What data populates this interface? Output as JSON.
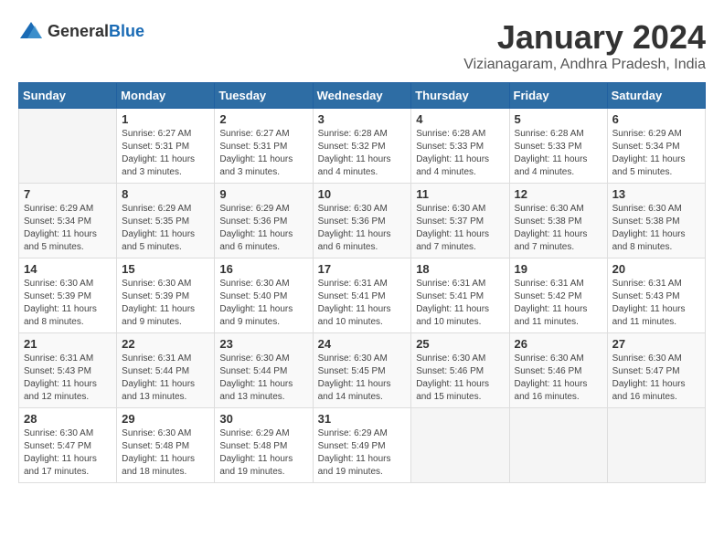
{
  "logo": {
    "text_general": "General",
    "text_blue": "Blue"
  },
  "header": {
    "month": "January 2024",
    "location": "Vizianagaram, Andhra Pradesh, India"
  },
  "days_of_week": [
    "Sunday",
    "Monday",
    "Tuesday",
    "Wednesday",
    "Thursday",
    "Friday",
    "Saturday"
  ],
  "weeks": [
    [
      {
        "day": "",
        "info": ""
      },
      {
        "day": "1",
        "info": "Sunrise: 6:27 AM\nSunset: 5:31 PM\nDaylight: 11 hours\nand 3 minutes."
      },
      {
        "day": "2",
        "info": "Sunrise: 6:27 AM\nSunset: 5:31 PM\nDaylight: 11 hours\nand 3 minutes."
      },
      {
        "day": "3",
        "info": "Sunrise: 6:28 AM\nSunset: 5:32 PM\nDaylight: 11 hours\nand 4 minutes."
      },
      {
        "day": "4",
        "info": "Sunrise: 6:28 AM\nSunset: 5:33 PM\nDaylight: 11 hours\nand 4 minutes."
      },
      {
        "day": "5",
        "info": "Sunrise: 6:28 AM\nSunset: 5:33 PM\nDaylight: 11 hours\nand 4 minutes."
      },
      {
        "day": "6",
        "info": "Sunrise: 6:29 AM\nSunset: 5:34 PM\nDaylight: 11 hours\nand 5 minutes."
      }
    ],
    [
      {
        "day": "7",
        "info": "Sunrise: 6:29 AM\nSunset: 5:34 PM\nDaylight: 11 hours\nand 5 minutes."
      },
      {
        "day": "8",
        "info": "Sunrise: 6:29 AM\nSunset: 5:35 PM\nDaylight: 11 hours\nand 5 minutes."
      },
      {
        "day": "9",
        "info": "Sunrise: 6:29 AM\nSunset: 5:36 PM\nDaylight: 11 hours\nand 6 minutes."
      },
      {
        "day": "10",
        "info": "Sunrise: 6:30 AM\nSunset: 5:36 PM\nDaylight: 11 hours\nand 6 minutes."
      },
      {
        "day": "11",
        "info": "Sunrise: 6:30 AM\nSunset: 5:37 PM\nDaylight: 11 hours\nand 7 minutes."
      },
      {
        "day": "12",
        "info": "Sunrise: 6:30 AM\nSunset: 5:38 PM\nDaylight: 11 hours\nand 7 minutes."
      },
      {
        "day": "13",
        "info": "Sunrise: 6:30 AM\nSunset: 5:38 PM\nDaylight: 11 hours\nand 8 minutes."
      }
    ],
    [
      {
        "day": "14",
        "info": "Sunrise: 6:30 AM\nSunset: 5:39 PM\nDaylight: 11 hours\nand 8 minutes."
      },
      {
        "day": "15",
        "info": "Sunrise: 6:30 AM\nSunset: 5:39 PM\nDaylight: 11 hours\nand 9 minutes."
      },
      {
        "day": "16",
        "info": "Sunrise: 6:30 AM\nSunset: 5:40 PM\nDaylight: 11 hours\nand 9 minutes."
      },
      {
        "day": "17",
        "info": "Sunrise: 6:31 AM\nSunset: 5:41 PM\nDaylight: 11 hours\nand 10 minutes."
      },
      {
        "day": "18",
        "info": "Sunrise: 6:31 AM\nSunset: 5:41 PM\nDaylight: 11 hours\nand 10 minutes."
      },
      {
        "day": "19",
        "info": "Sunrise: 6:31 AM\nSunset: 5:42 PM\nDaylight: 11 hours\nand 11 minutes."
      },
      {
        "day": "20",
        "info": "Sunrise: 6:31 AM\nSunset: 5:43 PM\nDaylight: 11 hours\nand 11 minutes."
      }
    ],
    [
      {
        "day": "21",
        "info": "Sunrise: 6:31 AM\nSunset: 5:43 PM\nDaylight: 11 hours\nand 12 minutes."
      },
      {
        "day": "22",
        "info": "Sunrise: 6:31 AM\nSunset: 5:44 PM\nDaylight: 11 hours\nand 13 minutes."
      },
      {
        "day": "23",
        "info": "Sunrise: 6:30 AM\nSunset: 5:44 PM\nDaylight: 11 hours\nand 13 minutes."
      },
      {
        "day": "24",
        "info": "Sunrise: 6:30 AM\nSunset: 5:45 PM\nDaylight: 11 hours\nand 14 minutes."
      },
      {
        "day": "25",
        "info": "Sunrise: 6:30 AM\nSunset: 5:46 PM\nDaylight: 11 hours\nand 15 minutes."
      },
      {
        "day": "26",
        "info": "Sunrise: 6:30 AM\nSunset: 5:46 PM\nDaylight: 11 hours\nand 16 minutes."
      },
      {
        "day": "27",
        "info": "Sunrise: 6:30 AM\nSunset: 5:47 PM\nDaylight: 11 hours\nand 16 minutes."
      }
    ],
    [
      {
        "day": "28",
        "info": "Sunrise: 6:30 AM\nSunset: 5:47 PM\nDaylight: 11 hours\nand 17 minutes."
      },
      {
        "day": "29",
        "info": "Sunrise: 6:30 AM\nSunset: 5:48 PM\nDaylight: 11 hours\nand 18 minutes."
      },
      {
        "day": "30",
        "info": "Sunrise: 6:29 AM\nSunset: 5:48 PM\nDaylight: 11 hours\nand 19 minutes."
      },
      {
        "day": "31",
        "info": "Sunrise: 6:29 AM\nSunset: 5:49 PM\nDaylight: 11 hours\nand 19 minutes."
      },
      {
        "day": "",
        "info": ""
      },
      {
        "day": "",
        "info": ""
      },
      {
        "day": "",
        "info": ""
      }
    ]
  ]
}
